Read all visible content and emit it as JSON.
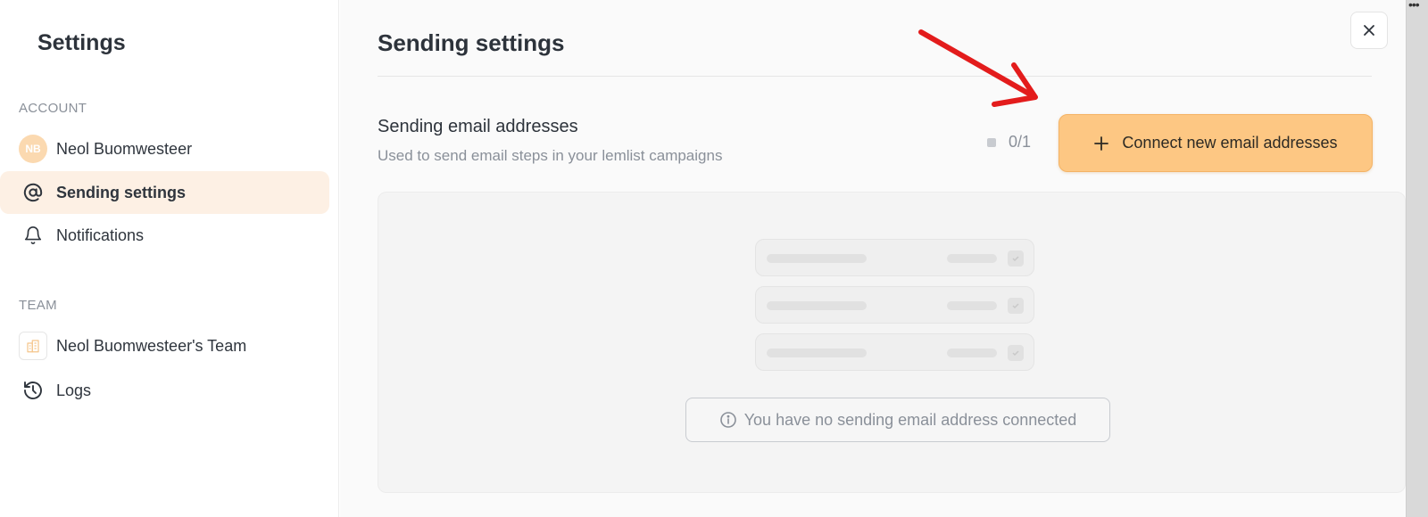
{
  "sidebar": {
    "title": "Settings",
    "account_label": "ACCOUNT",
    "team_label": "TEAM",
    "items": [
      {
        "label": "Neol Buomwesteer",
        "avatar_initials": "NB",
        "icon": "avatar"
      },
      {
        "label": "Sending settings",
        "icon": "at-icon",
        "active": true
      },
      {
        "label": "Notifications",
        "icon": "bell-icon"
      },
      {
        "label": "Neol Buomwesteer's Team",
        "icon": "building-icon"
      },
      {
        "label": "Logs",
        "icon": "history-icon"
      }
    ]
  },
  "main": {
    "title": "Sending settings",
    "section_title": "Sending email addresses",
    "section_subtitle": "Used to send email steps in your lemlist campaigns",
    "counter": "0/1",
    "connect_button_label": "Connect new email addresses",
    "empty_message": "You have no sending email address connected"
  },
  "colors": {
    "accent": "#fdc783",
    "active_bg": "#fdf0e4",
    "annotation_arrow": "#e31c1c"
  }
}
